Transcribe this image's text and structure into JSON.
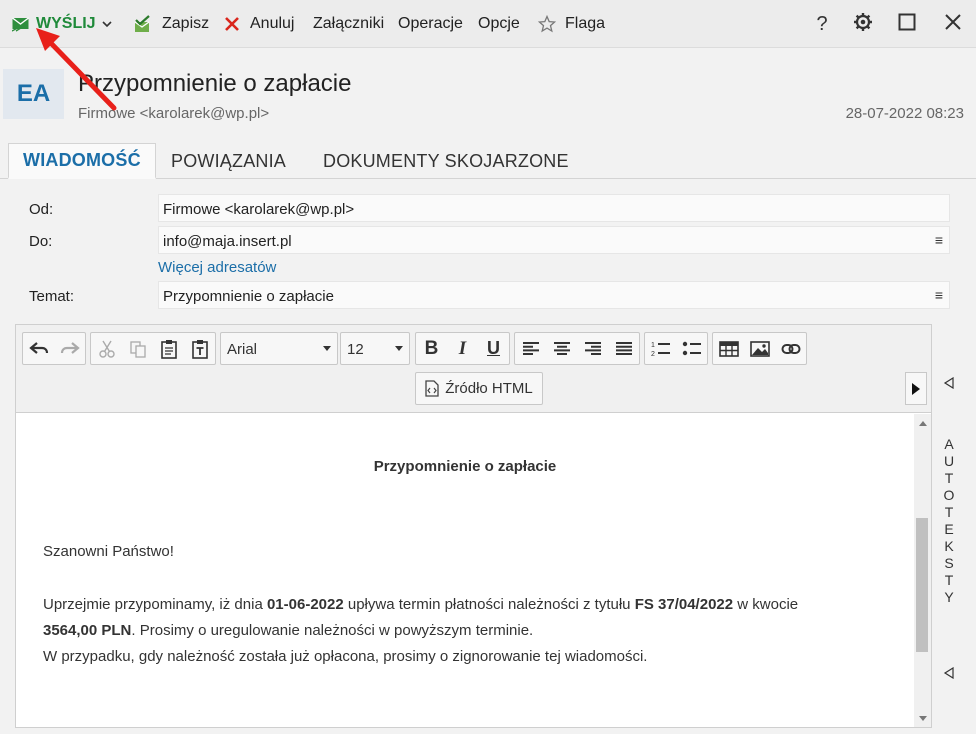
{
  "toolbar": {
    "send_label": "WYŚLIJ",
    "save_label": "Zapisz",
    "cancel_label": "Anuluj",
    "attachments_label": "Załączniki",
    "operations_label": "Operacje",
    "options_label": "Opcje",
    "flag_label": "Flaga"
  },
  "header": {
    "avatar_initials": "EA",
    "subject": "Przypomnienie o zapłacie",
    "sender": "Firmowe <karolarek@wp.pl>",
    "date": "28-07-2022 08:23"
  },
  "tabs": [
    {
      "label": "WIADOMOŚĆ",
      "active": true
    },
    {
      "label": "POWIĄZANIA",
      "active": false
    },
    {
      "label": "DOKUMENTY SKOJARZONE",
      "active": false
    }
  ],
  "form": {
    "from_label": "Od:",
    "from_value": "Firmowe <karolarek@wp.pl>",
    "to_label": "Do:",
    "to_value": "info@maja.insert.pl",
    "more_addresses": "Więcej adresatów",
    "subject_label": "Temat:",
    "subject_value": "Przypomnienie o zapłacie"
  },
  "editor": {
    "font_family": "Arial",
    "font_size": "12",
    "html_source_label": "Źródło HTML"
  },
  "message": {
    "title": "Przypomnienie o zapłacie",
    "greeting": "Szanowni Państwo!",
    "p1_a": "Uprzejmie przypominamy, iż dnia ",
    "p1_date": "01-06-2022",
    "p1_b": " upływa termin płatności należności z tytułu ",
    "p1_invoice": "FS 37/04/2022",
    "p1_c": " w kwocie",
    "p1_amount": "3564,00 PLN",
    "p1_d": ". Prosimy o uregulowanie należności w powyższym terminie.",
    "p2": "W przypadku, gdy należność została już opłacona, prosimy o zignorowanie tej wiadomości."
  },
  "side_panel": {
    "label": "AUTOTEKSTY"
  },
  "colors": {
    "accent": "#1b6ea8",
    "send_green": "#1f8a3a",
    "cancel_red": "#d9261c",
    "annotation_red": "#e8201a"
  }
}
